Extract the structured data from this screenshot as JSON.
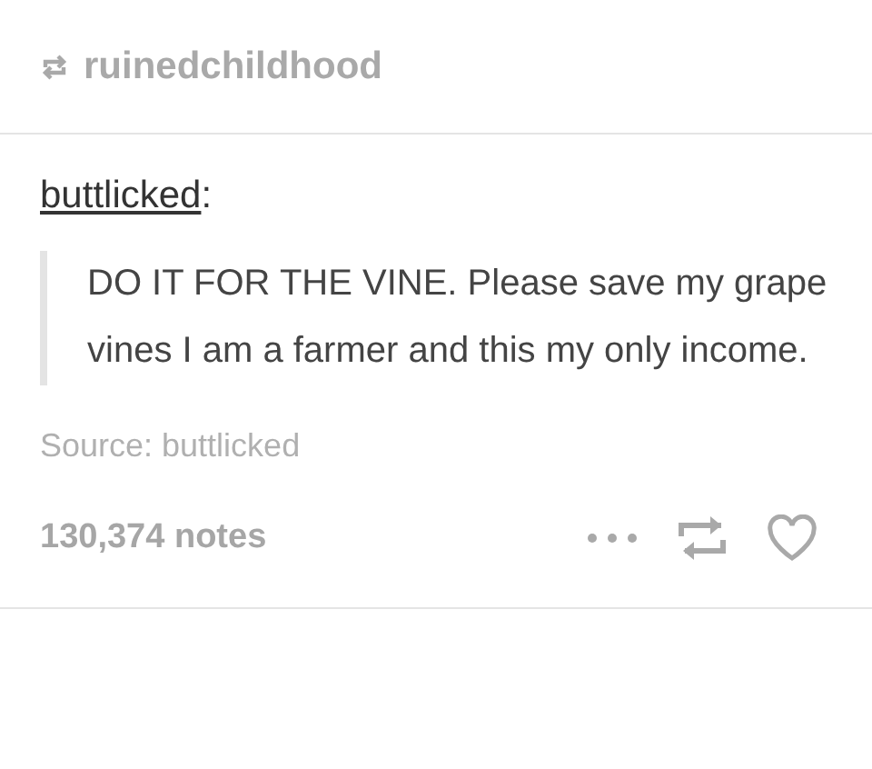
{
  "reblog": {
    "username": "ruinedchildhood"
  },
  "post": {
    "author": "buttlicked",
    "separator": ":",
    "quote": "DO IT FOR THE VINE. Please save my grape vines I am a farmer and this my only income.",
    "source": "Source: buttlicked"
  },
  "footer": {
    "notes": "130,374 notes",
    "liked": false
  }
}
